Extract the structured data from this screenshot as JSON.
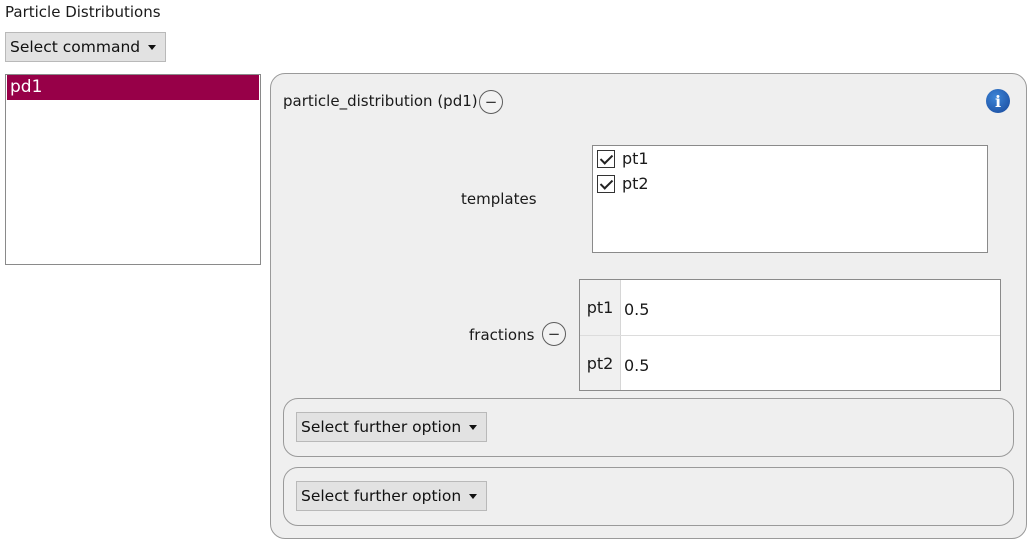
{
  "page": {
    "title": "Particle Distributions"
  },
  "command": {
    "label": "Select command",
    "icon": "chevron-down-icon"
  },
  "distribution_list": {
    "items": [
      {
        "label": "pd1",
        "selected": true
      }
    ]
  },
  "panel": {
    "header": "particle_distribution (pd1)",
    "collapse_icon": "minus-circle-icon",
    "info_icon": "info-icon",
    "info_glyph": "i",
    "templates": {
      "label": "templates",
      "items": [
        {
          "label": "pt1",
          "checked": true
        },
        {
          "label": "pt2",
          "checked": true
        }
      ]
    },
    "fractions": {
      "label": "fractions",
      "rows": [
        {
          "key": "pt1",
          "value": "0.5"
        },
        {
          "key": "pt2",
          "value": "0.5"
        }
      ]
    },
    "further_options": [
      {
        "label": "Select further option"
      },
      {
        "label": "Select further option"
      }
    ]
  },
  "colors": {
    "selection": "#970048",
    "info": "#1b5db6",
    "panel_bg": "#efefef"
  }
}
